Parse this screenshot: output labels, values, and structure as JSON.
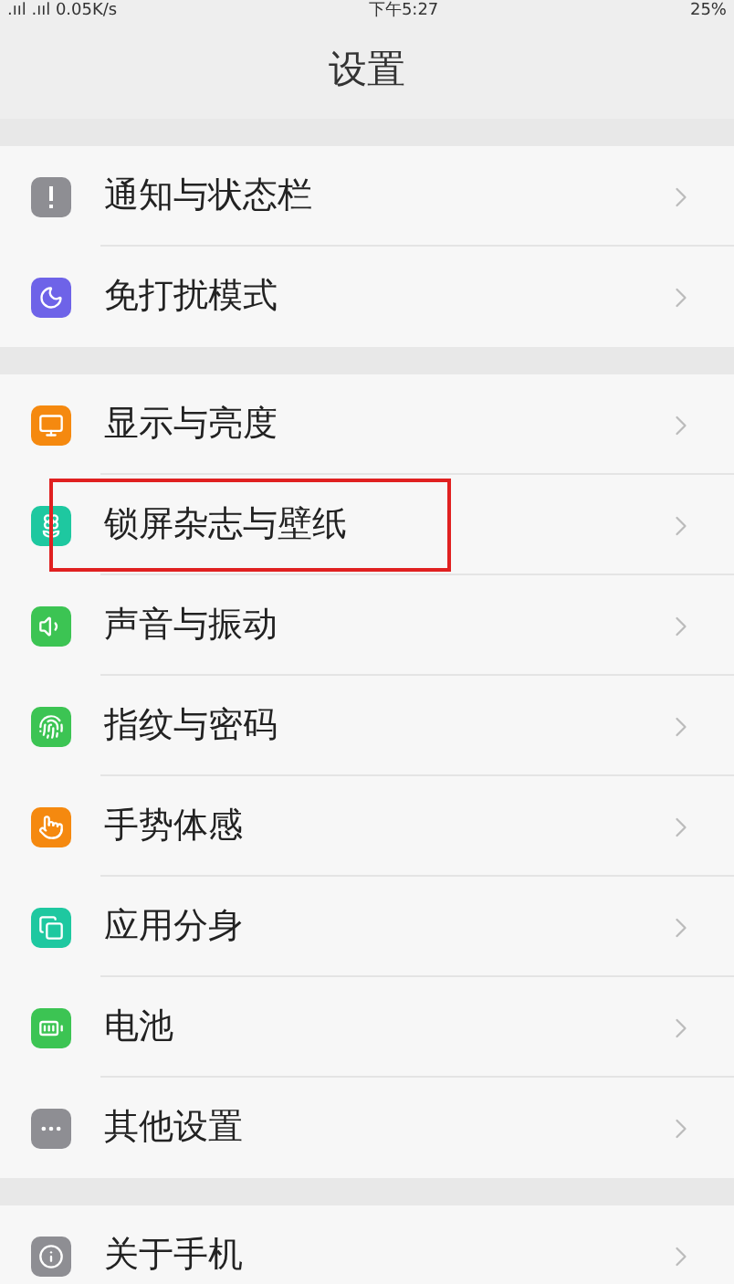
{
  "status_bar": {
    "network": ".ııl .ııl 0.05K/s",
    "time": "下午5:27",
    "battery": "25%"
  },
  "header": {
    "title": "设置"
  },
  "groups": [
    {
      "items": [
        {
          "label": "通知与状态栏",
          "color": "#8e8e93",
          "highlighted": false
        },
        {
          "label": "免打扰模式",
          "color": "#6e63e8",
          "highlighted": false
        }
      ]
    },
    {
      "items": [
        {
          "label": "显示与亮度",
          "color": "#f5890f",
          "highlighted": false
        },
        {
          "label": "锁屏杂志与壁纸",
          "color": "#1ec8a0",
          "highlighted": true
        },
        {
          "label": "声音与振动",
          "color": "#3cc453",
          "highlighted": false
        },
        {
          "label": "指纹与密码",
          "color": "#3cc453",
          "highlighted": false
        },
        {
          "label": "手势体感",
          "color": "#f5890f",
          "highlighted": false
        },
        {
          "label": "应用分身",
          "color": "#1ec8a0",
          "highlighted": false
        },
        {
          "label": "电池",
          "color": "#3cc453",
          "highlighted": false
        },
        {
          "label": "其他设置",
          "color": "#8e8e93",
          "highlighted": false
        }
      ]
    },
    {
      "items": [
        {
          "label": "关于手机",
          "color": "#8e8e93",
          "highlighted": false
        }
      ]
    }
  ]
}
